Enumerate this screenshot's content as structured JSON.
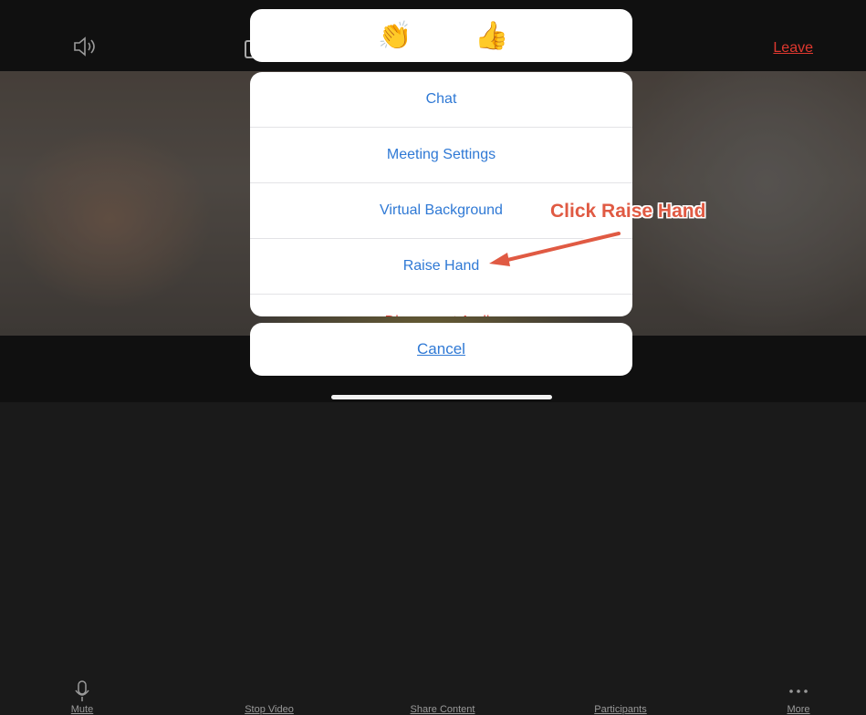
{
  "top_bar": {
    "leave_label": "Leave"
  },
  "reactions": [
    {
      "emoji": "👏",
      "icon": "clap-icon"
    },
    {
      "emoji": "👍",
      "icon": "thumbs-up-icon"
    }
  ],
  "menu": {
    "items": [
      {
        "label": "Chat"
      },
      {
        "label": "Meeting Settings"
      },
      {
        "label": "Virtual Background"
      },
      {
        "label": "Raise Hand"
      },
      {
        "label": "Disconnect Audio"
      }
    ],
    "cancel_label": "Cancel"
  },
  "toolbar": {
    "items": [
      {
        "label": "Mute",
        "icon": "microphone-icon"
      },
      {
        "label": "Stop Video",
        "icon": "video-camera-icon"
      },
      {
        "label": "Share Content",
        "icon": "share-icon"
      },
      {
        "label": "Participants",
        "icon": "participants-icon"
      },
      {
        "label": "More",
        "icon": "more-dots-icon"
      }
    ]
  },
  "annotation": {
    "text": "Click Raise Hand",
    "color": "#e05a43"
  },
  "colors": {
    "menu_text": "#2f79d5",
    "leave": "#e0382f",
    "destructive": "#d8392f"
  }
}
